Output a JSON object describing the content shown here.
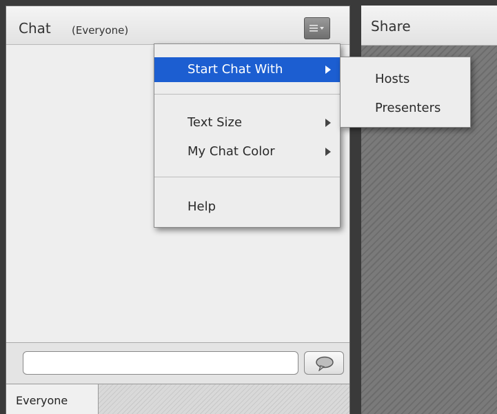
{
  "chat_pod": {
    "title": "Chat",
    "audience": "(Everyone)",
    "menu_button_icon": "pod-options-menu-icon",
    "input": {
      "value": "",
      "placeholder": ""
    },
    "send_icon": "speech-bubble-icon",
    "tabs": [
      {
        "label": "Everyone"
      }
    ]
  },
  "share_pod": {
    "title": "Share"
  },
  "menu": {
    "items": [
      {
        "label": "Start Chat With",
        "has_submenu": true,
        "highlighted": true
      },
      {
        "label": "Text Size",
        "has_submenu": true
      },
      {
        "label": "My Chat Color",
        "has_submenu": true
      },
      {
        "label": "Help",
        "has_submenu": false
      }
    ],
    "highlight_color": "#1c5ed1"
  },
  "submenu": {
    "items": [
      {
        "label": "Hosts"
      },
      {
        "label": "Presenters"
      }
    ]
  }
}
